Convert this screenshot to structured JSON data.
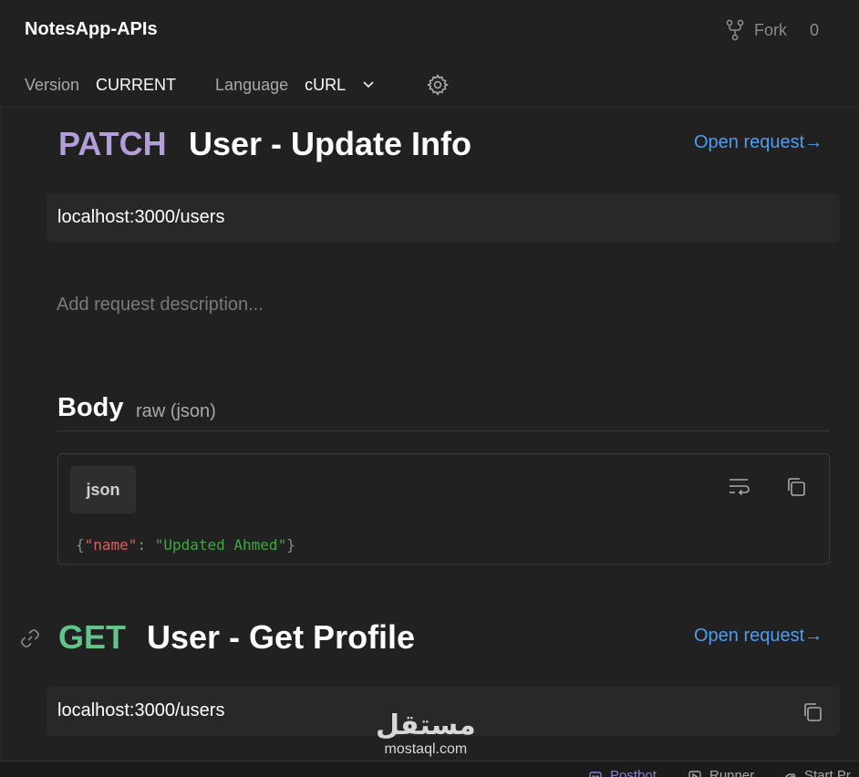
{
  "header": {
    "app_title": "NotesApp-APIs",
    "fork_label": "Fork",
    "fork_count": "0"
  },
  "toolbar": {
    "version_label": "Version",
    "version_value": "CURRENT",
    "language_label": "Language",
    "language_value": "cURL"
  },
  "requests": [
    {
      "method": "PATCH",
      "method_color": "#b39ddb",
      "title": "User - Update Info",
      "open_request": "Open request→",
      "url": "localhost:3000/users",
      "description_placeholder": "Add request description...",
      "body": {
        "title": "Body",
        "subtitle": "raw (json)",
        "tab": "json",
        "code": {
          "open_brace": "{",
          "key": "\"name\"",
          "colon": ": ",
          "value": "\"Updated Ahmed\"",
          "close_brace": "}"
        }
      }
    },
    {
      "method": "GET",
      "method_color": "#62c48a",
      "title": "User - Get Profile",
      "open_request": "Open request→",
      "url": "localhost:3000/users"
    }
  ],
  "watermark": {
    "arabic": "مستقل",
    "latin": "mostaql.com"
  },
  "statusbar": {
    "postbot": "Postbot",
    "runner": "Runner",
    "start_proxy": "Start Pr"
  }
}
